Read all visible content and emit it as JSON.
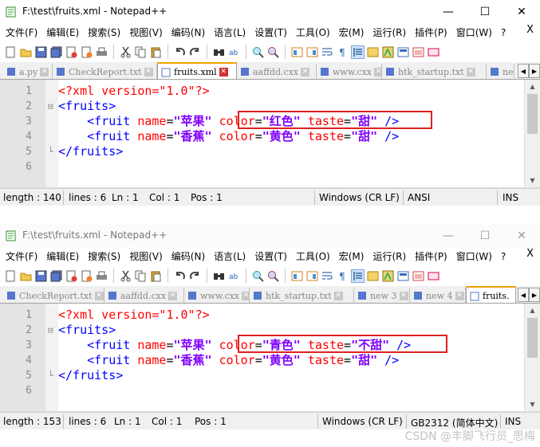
{
  "window1": {
    "title": "F:\\test\\fruits.xml - Notepad++",
    "menu": [
      "文件(F)",
      "编辑(E)",
      "搜索(S)",
      "视图(V)",
      "编码(N)",
      "语言(L)",
      "设置(T)",
      "工具(O)",
      "宏(M)",
      "运行(R)",
      "插件(P)",
      "窗口(W)",
      "?"
    ],
    "menu_close": "X",
    "tabs": [
      {
        "label": "a.py"
      },
      {
        "label": "CheckReport.txt"
      },
      {
        "label": "fruits.xml",
        "active": true
      },
      {
        "label": "aaffdd.cxx"
      },
      {
        "label": "www.cxx"
      },
      {
        "label": "htk_startup.txt"
      },
      {
        "label": "ne"
      }
    ],
    "lines": [
      {
        "num": "1",
        "parts": [
          {
            "t": "<?xml version=\"1.0\"?>",
            "c": "pi"
          }
        ]
      },
      {
        "num": "2",
        "fold": "⊟",
        "parts": [
          {
            "t": "<fruits>",
            "c": "tag"
          }
        ]
      },
      {
        "num": "3",
        "parts": [
          {
            "t": "    <fruit ",
            "c": "tag"
          },
          {
            "t": "name",
            "c": "attr"
          },
          {
            "t": "=",
            "c": "eq"
          },
          {
            "t": "\"苹果\"",
            "c": "val"
          },
          {
            "t": " color",
            "c": "attr"
          },
          {
            "t": "=",
            "c": "eq"
          },
          {
            "t": "\"红色\"",
            "c": "val"
          },
          {
            "t": " taste",
            "c": "attr"
          },
          {
            "t": "=",
            "c": "eq"
          },
          {
            "t": "\"甜\"",
            "c": "val"
          },
          {
            "t": " />",
            "c": "tag"
          }
        ]
      },
      {
        "num": "4",
        "parts": [
          {
            "t": "    <fruit ",
            "c": "tag"
          },
          {
            "t": "name",
            "c": "attr"
          },
          {
            "t": "=",
            "c": "eq"
          },
          {
            "t": "\"香蕉\"",
            "c": "val"
          },
          {
            "t": " color",
            "c": "attr"
          },
          {
            "t": "=",
            "c": "eq"
          },
          {
            "t": "\"黄色\"",
            "c": "val"
          },
          {
            "t": " taste",
            "c": "attr"
          },
          {
            "t": "=",
            "c": "eq"
          },
          {
            "t": "\"甜\"",
            "c": "val"
          },
          {
            "t": " />",
            "c": "tag"
          }
        ]
      },
      {
        "num": "5",
        "fold": "└",
        "parts": [
          {
            "t": "</fruits>",
            "c": "tag"
          }
        ]
      },
      {
        "num": "6",
        "parts": []
      }
    ],
    "status": {
      "length": "length : 140",
      "lines": "lines : 6",
      "ln": "Ln : 1",
      "col": "Col : 1",
      "pos": "Pos : 1",
      "eol": "Windows (CR LF)",
      "encoding": "ANSI",
      "mode": "INS"
    }
  },
  "window2": {
    "title": "F:\\test\\fruits.xml - Notepad++",
    "menu": [
      "文件(F)",
      "编辑(E)",
      "搜索(S)",
      "视图(V)",
      "编码(N)",
      "语言(L)",
      "设置(T)",
      "工具(O)",
      "宏(M)",
      "运行(R)",
      "插件(P)",
      "窗口(W)",
      "?"
    ],
    "menu_close": "X",
    "tabs": [
      {
        "label": "CheckReport.txt"
      },
      {
        "label": "aaffdd.cxx"
      },
      {
        "label": "www.cxx"
      },
      {
        "label": "htk_startup.txt"
      },
      {
        "label": "new 3"
      },
      {
        "label": "new 4"
      },
      {
        "label": "fruits.",
        "active": true
      }
    ],
    "lines": [
      {
        "num": "1",
        "parts": [
          {
            "t": "<?xml version=\"1.0\"?>",
            "c": "pi"
          }
        ]
      },
      {
        "num": "2",
        "fold": "⊟",
        "parts": [
          {
            "t": "<fruits>",
            "c": "tag"
          }
        ]
      },
      {
        "num": "3",
        "parts": [
          {
            "t": "    <fruit ",
            "c": "tag"
          },
          {
            "t": "name",
            "c": "attr"
          },
          {
            "t": "=",
            "c": "eq"
          },
          {
            "t": "\"苹果\"",
            "c": "val"
          },
          {
            "t": " color",
            "c": "attr"
          },
          {
            "t": "=",
            "c": "eq"
          },
          {
            "t": "\"青色\"",
            "c": "val"
          },
          {
            "t": " taste",
            "c": "attr"
          },
          {
            "t": "=",
            "c": "eq"
          },
          {
            "t": "\"不甜\"",
            "c": "val"
          },
          {
            "t": " />",
            "c": "tag"
          }
        ]
      },
      {
        "num": "4",
        "parts": [
          {
            "t": "    <fruit ",
            "c": "tag"
          },
          {
            "t": "name",
            "c": "attr"
          },
          {
            "t": "=",
            "c": "eq"
          },
          {
            "t": "\"香蕉\"",
            "c": "val"
          },
          {
            "t": " color",
            "c": "attr"
          },
          {
            "t": "=",
            "c": "eq"
          },
          {
            "t": "\"黄色\"",
            "c": "val"
          },
          {
            "t": " taste",
            "c": "attr"
          },
          {
            "t": "=",
            "c": "eq"
          },
          {
            "t": "\"甜\"",
            "c": "val"
          },
          {
            "t": " />",
            "c": "tag"
          }
        ]
      },
      {
        "num": "5",
        "fold": "└",
        "parts": [
          {
            "t": "</fruits>",
            "c": "tag"
          }
        ]
      },
      {
        "num": "6",
        "parts": []
      }
    ],
    "status": {
      "length": "length : 153",
      "lines": "lines : 6",
      "ln": "Ln : 1",
      "col": "Col : 1",
      "pos": "Pos : 1",
      "eol": "Windows (CR LF)",
      "encoding": "GB2312 (简体中文)",
      "mode": "INS"
    }
  },
  "watermark": "CSDN @丰脚飞行员_思梅",
  "colors": {
    "pi": "#ff0000",
    "tag": "#0000ff",
    "attr": "#ff0000",
    "value": "#8000ff",
    "highlight": "#e02020",
    "active_tab": "#f5a000"
  }
}
